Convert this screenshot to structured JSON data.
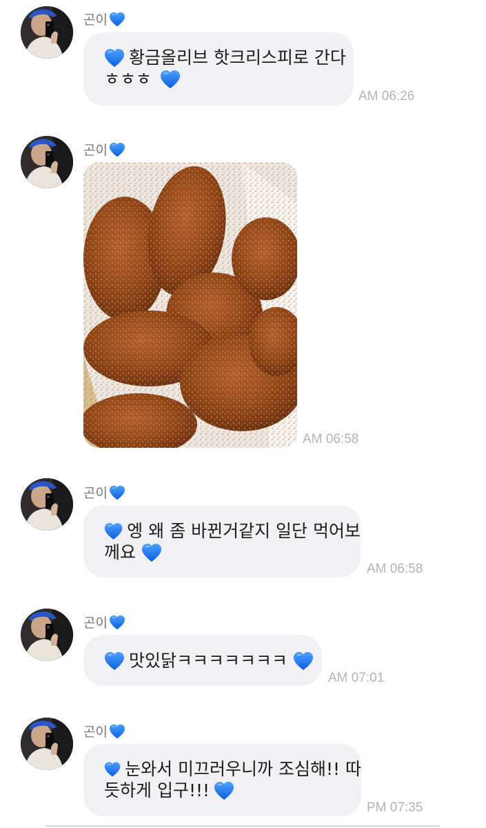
{
  "chat": {
    "messages": [
      {
        "sender": "곤이",
        "lines": [
          "황금올리브 핫크리스피로 간다",
          "ㅎㅎㅎ"
        ],
        "time": "AM 06:26"
      },
      {
        "sender": "곤이",
        "image": "fried chicken photo",
        "time": "AM 06:58"
      },
      {
        "sender": "곤이",
        "lines": [
          "엥 왜 좀 바뀐거같지 일단 먹어보",
          "께요"
        ],
        "time": "AM 06:58"
      },
      {
        "sender": "곤이",
        "lines": [
          "맛있닭ㅋㅋㅋㅋㅋㅋㅋ"
        ],
        "time": "AM 07:01"
      },
      {
        "sender": "곤이",
        "lines": [
          "눈와서 미끄러우니까 조심해!! 따",
          "듯하게 입구!!!"
        ],
        "time": "PM 07:35"
      }
    ]
  },
  "colors": {
    "bubble": "#f1f1f3",
    "heart": "#1a6ff2",
    "time": "#b4b4b4"
  },
  "icons": {
    "heart": "blue-heart-icon"
  }
}
